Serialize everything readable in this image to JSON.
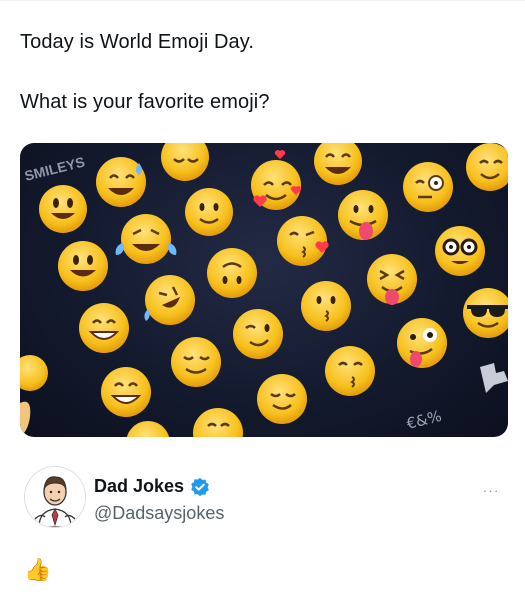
{
  "tweet": {
    "line1": "Today is World Emoji Day.",
    "line2": "What is your favorite emoji?"
  },
  "media": {
    "label": "SMILEYS",
    "symbols_label": "€&%",
    "emoji_icons": [
      "sweat-smile",
      "smiling-face",
      "grin-sweat",
      "halo-face",
      "heart-eyes-face",
      "kiss-heart-face",
      "tongue-out-face",
      "monocle-face",
      "smiling-face",
      "nerd-face",
      "sunglasses-face",
      "zany-face",
      "squint-tongue-face",
      "tears-of-joy-face",
      "upside-down-face",
      "rolling-laugh-face",
      "winking-face",
      "kissing-face",
      "relieved-face",
      "kissing-smiling-eyes-face",
      "beaming-face",
      "grinning-face",
      "wink-face",
      "flag-icon"
    ]
  },
  "author": {
    "name": "Dad Jokes",
    "handle": "@Dadsaysjokes",
    "verified": true,
    "verified_color": "#1d9bf0"
  },
  "more_label": "···",
  "reply": {
    "text": "👍",
    "emoji_icon": "thumbs-up-icon"
  },
  "colors": {
    "text": "#0f1419",
    "secondary": "#536471",
    "emoji_yellow": "#f7c01c"
  }
}
